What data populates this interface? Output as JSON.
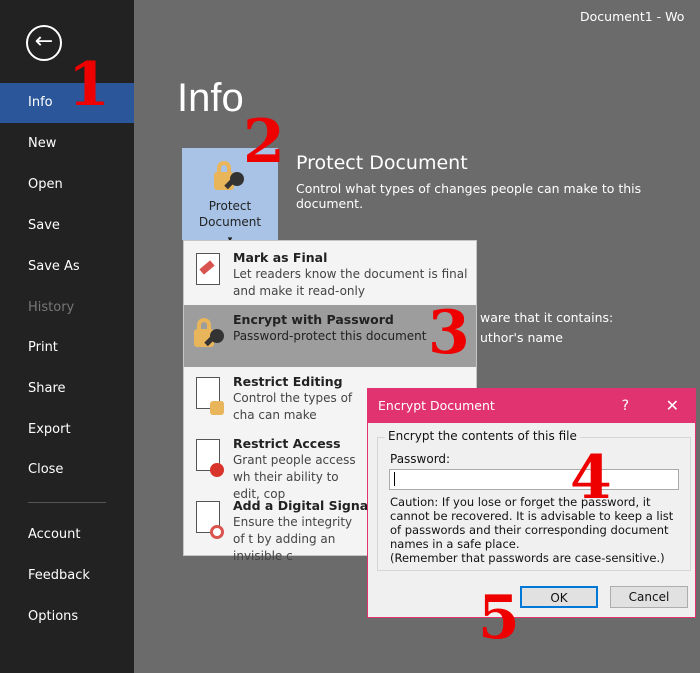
{
  "window": {
    "title": "Document1 - Wo"
  },
  "sidebar": {
    "items": [
      {
        "label": "Info"
      },
      {
        "label": "New"
      },
      {
        "label": "Open"
      },
      {
        "label": "Save"
      },
      {
        "label": "Save As"
      },
      {
        "label": "History"
      },
      {
        "label": "Print"
      },
      {
        "label": "Share"
      },
      {
        "label": "Export"
      },
      {
        "label": "Close"
      },
      {
        "label": "Account"
      },
      {
        "label": "Feedback"
      },
      {
        "label": "Options"
      }
    ]
  },
  "main": {
    "title": "Info",
    "protect_button": "Protect Document",
    "protect_button_arrow": "▾",
    "protect_heading": "Protect Document",
    "protect_desc": "Control what types of changes people can make to this document.",
    "bg_line1": "ware that it contains:",
    "bg_line2": "uthor's name"
  },
  "menu": {
    "items": [
      {
        "title": "Mark as Final",
        "desc": "Let readers know the document is final and make it read-only"
      },
      {
        "title": "Encrypt with Password",
        "desc": "Password-protect this document"
      },
      {
        "title": "Restrict Editing",
        "desc": "Control the types of cha can make"
      },
      {
        "title": "Restrict Access",
        "desc": "Grant people access wh their ability to edit, cop"
      },
      {
        "title": "Add a Digital Signature",
        "desc": "Ensure the integrity of t by adding an invisible c"
      }
    ]
  },
  "dialog": {
    "title": "Encrypt Document",
    "help": "?",
    "close": "✕",
    "group": "Encrypt the contents of this file",
    "password_label": "Password:",
    "password_value": "",
    "caution": "Caution: If you lose or forget the password, it cannot be recovered. It is advisable to keep a list of passwords and their corresponding document names in a safe place.",
    "reminder": "(Remember that passwords are case-sensitive.)",
    "ok": "OK",
    "cancel": "Cancel"
  },
  "annotations": [
    "1",
    "2",
    "3",
    "4",
    "5"
  ],
  "colors": {
    "accent": "#2b579a",
    "dialog": "#e0336f",
    "annotation": "#ee0000"
  }
}
